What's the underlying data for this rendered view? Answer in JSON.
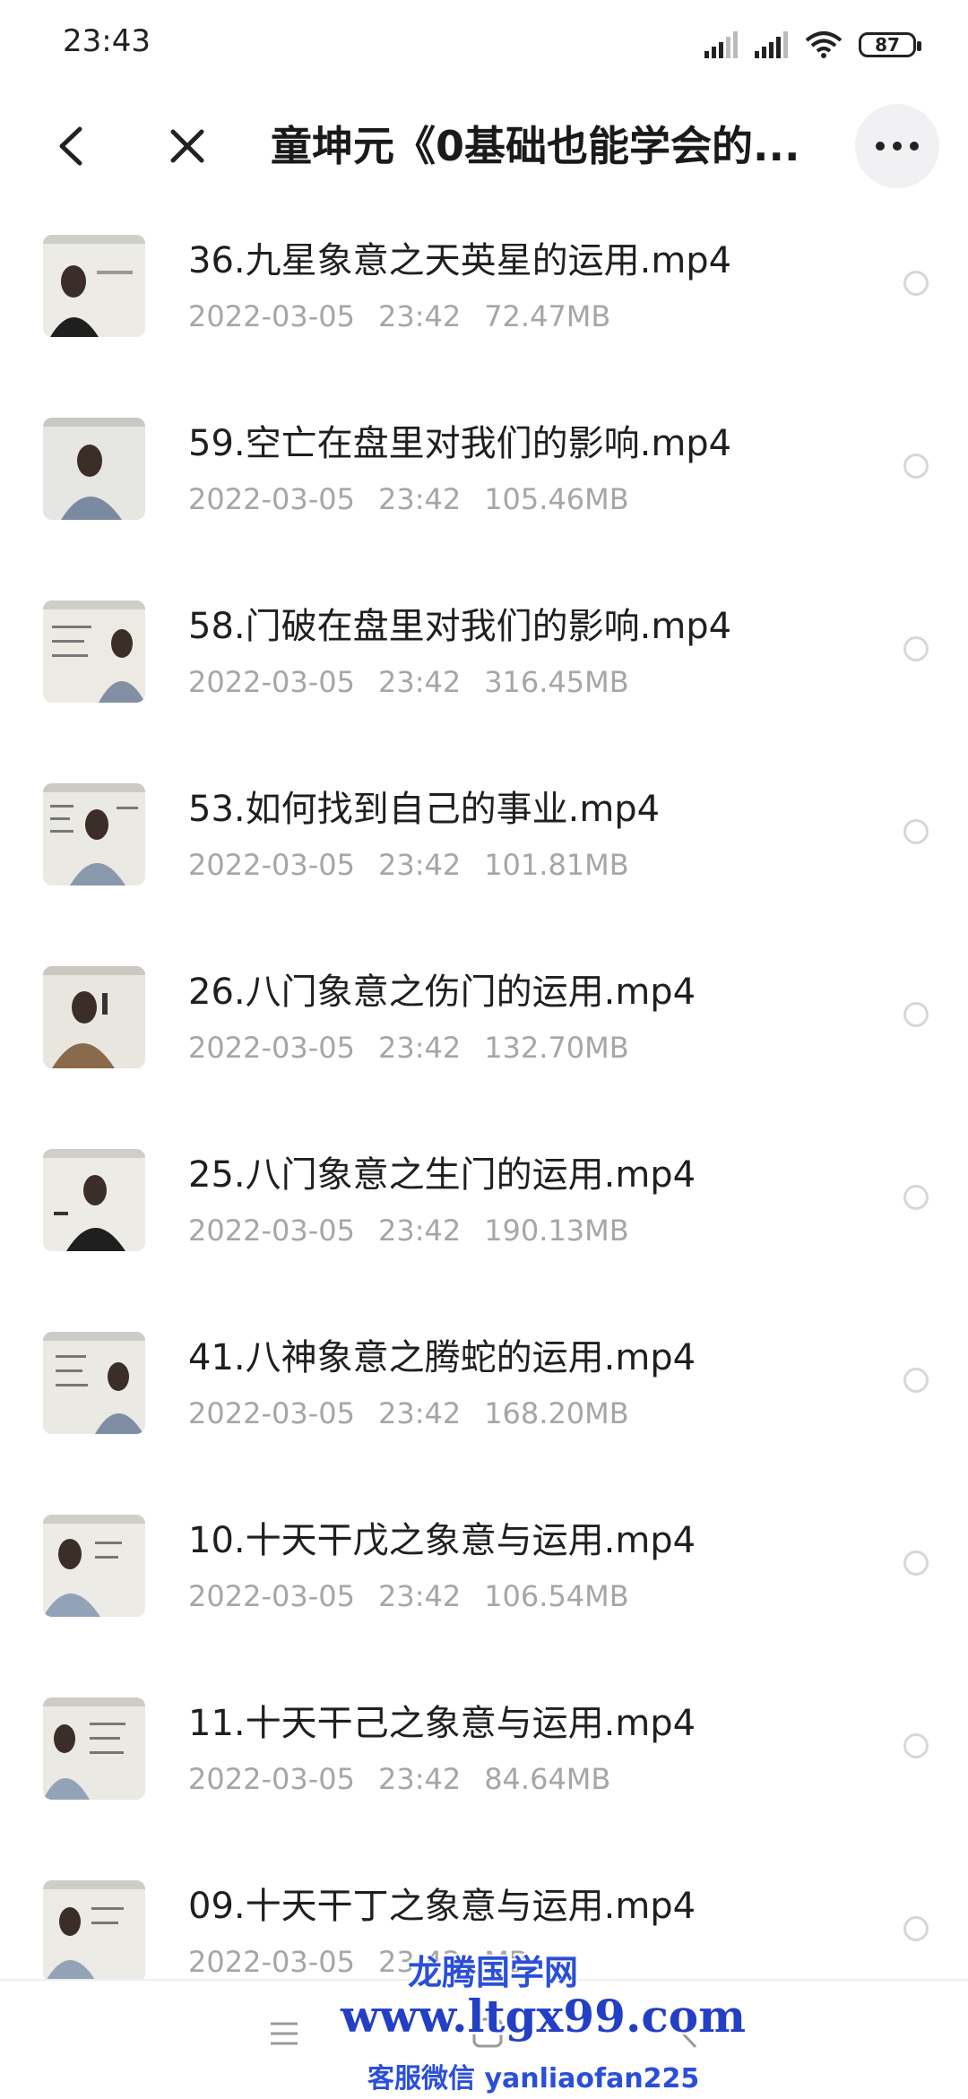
{
  "status_bar": {
    "time": "23:43",
    "battery": "87"
  },
  "header": {
    "title": "童坤元《0基础也能学会的..."
  },
  "files": [
    {
      "name": "36.九星象意之天英星的运用.mp4",
      "date": "2022-03-05",
      "time": "23:42",
      "size": "72.47MB"
    },
    {
      "name": "59.空亡在盘里对我们的影响.mp4",
      "date": "2022-03-05",
      "time": "23:42",
      "size": "105.46MB"
    },
    {
      "name": "58.门破在盘里对我们的影响.mp4",
      "date": "2022-03-05",
      "time": "23:42",
      "size": "316.45MB"
    },
    {
      "name": "53.如何找到自己的事业.mp4",
      "date": "2022-03-05",
      "time": "23:42",
      "size": "101.81MB"
    },
    {
      "name": "26.八门象意之伤门的运用.mp4",
      "date": "2022-03-05",
      "time": "23:42",
      "size": "132.70MB"
    },
    {
      "name": "25.八门象意之生门的运用.mp4",
      "date": "2022-03-05",
      "time": "23:42",
      "size": "190.13MB"
    },
    {
      "name": "41.八神象意之腾蛇的运用.mp4",
      "date": "2022-03-05",
      "time": "23:42",
      "size": "168.20MB"
    },
    {
      "name": "10.十天干戊之象意与运用.mp4",
      "date": "2022-03-05",
      "time": "23:42",
      "size": "106.54MB"
    },
    {
      "name": "11.十天干己之象意与运用.mp4",
      "date": "2022-03-05",
      "time": "23:42",
      "size": "84.64MB"
    },
    {
      "name": "09.十天干丁之象意与运用.mp4",
      "date": "2022-03-05",
      "time": "23:42",
      "size": "MB"
    }
  ],
  "watermark": {
    "line1": "龙腾国学网",
    "line2": "www.ltgx99.com",
    "line3": "客服微信 yanliaofan225"
  },
  "icons": {
    "back": "chevron-left-icon",
    "close": "close-icon",
    "more": "more-dots-icon"
  }
}
